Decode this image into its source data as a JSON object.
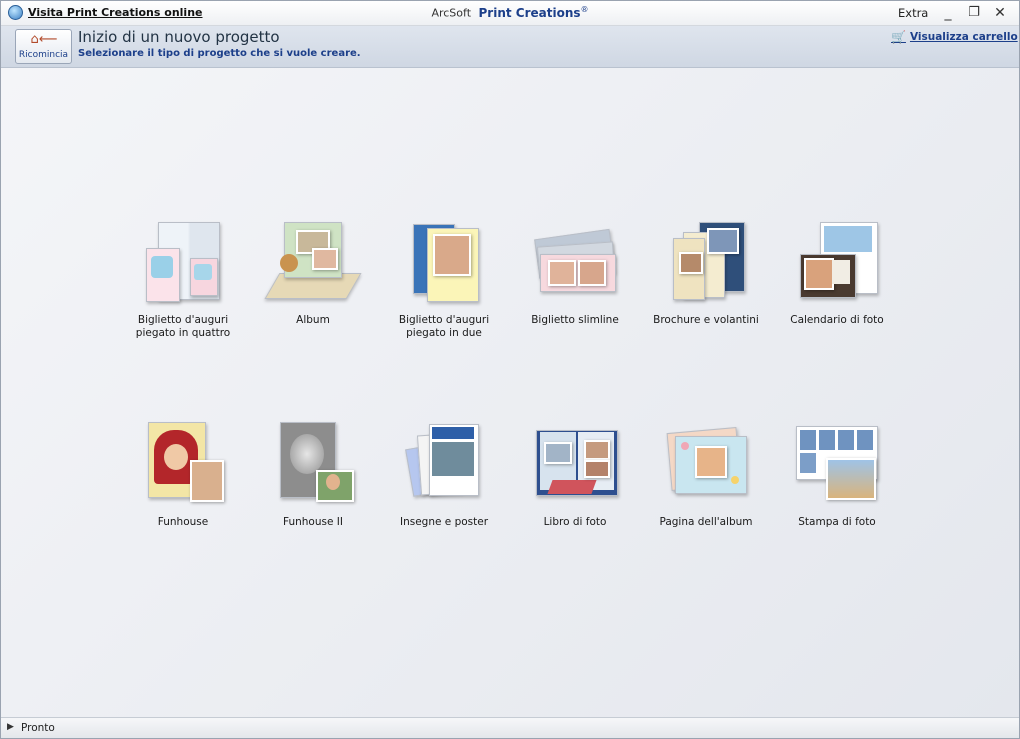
{
  "titlebar": {
    "visit_link": "Visita Print Creations online",
    "app_vendor": "ArcSoft",
    "app_name": "Print Creations",
    "app_mark": "®",
    "extra_menu": "Extra",
    "minimize": "_",
    "restore": "❐",
    "close": "✕"
  },
  "header": {
    "restart_label": "Ricomincia",
    "title": "Inizio di un nuovo progetto",
    "subtitle": "Selezionare il tipo di progetto che si vuole creare.",
    "cart_link": "Visualizza carrello"
  },
  "projects": {
    "row1": [
      {
        "label_line1": "Biglietto d'auguri",
        "label_line2": "piegato in quattro"
      },
      {
        "label_line1": "Album",
        "label_line2": ""
      },
      {
        "label_line1": "Biglietto d'auguri",
        "label_line2": "piegato in due"
      },
      {
        "label_line1": "Biglietto slimline",
        "label_line2": ""
      },
      {
        "label_line1": "Brochure e volantini",
        "label_line2": ""
      },
      {
        "label_line1": "Calendario di foto",
        "label_line2": ""
      }
    ],
    "row2": [
      {
        "label_line1": "Funhouse",
        "label_line2": ""
      },
      {
        "label_line1": "Funhouse II",
        "label_line2": ""
      },
      {
        "label_line1": "Insegne e poster",
        "label_line2": ""
      },
      {
        "label_line1": "Libro di foto",
        "label_line2": ""
      },
      {
        "label_line1": "Pagina dell'album",
        "label_line2": ""
      },
      {
        "label_line1": "Stampa di foto",
        "label_line2": ""
      }
    ]
  },
  "statusbar": {
    "text": "Pronto"
  },
  "colors": {
    "accent": "#1c3f8a",
    "header_bg": "#d6dde8",
    "content_bg": "#eef0f4"
  }
}
